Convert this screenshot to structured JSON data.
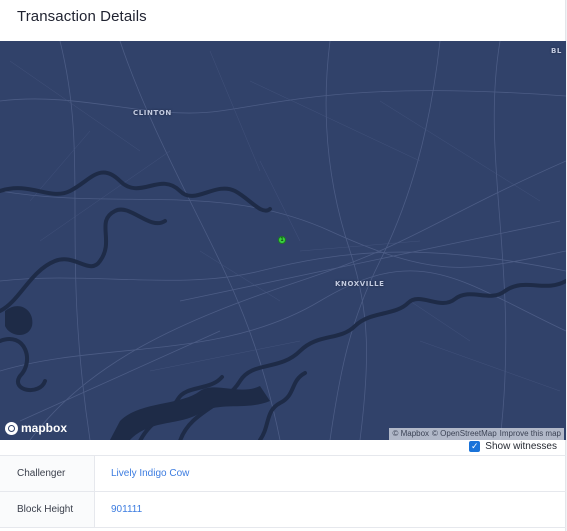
{
  "header": {
    "title": "Transaction Details"
  },
  "map": {
    "places": {
      "clinton": "CLINTON",
      "knoxville": "KNOXVILLE",
      "edge": "BL"
    },
    "hotspot_count": "1",
    "logo_text": "mapbox",
    "attribution": [
      "© Mapbox",
      "© OpenStreetMap",
      "Improve this map"
    ],
    "colors": {
      "background": "#31426a",
      "water": "#1e2b47",
      "roads": "#55658d",
      "hotspot": "#3ad13f"
    }
  },
  "witness_toggle": {
    "label": "Show witnesses",
    "checked": true
  },
  "details": [
    {
      "label": "Challenger",
      "value": "Lively Indigo Cow"
    },
    {
      "label": "Block Height",
      "value": "901111"
    }
  ],
  "colors": {
    "link": "#3c7ce0",
    "checkbox": "#1a73d9"
  }
}
